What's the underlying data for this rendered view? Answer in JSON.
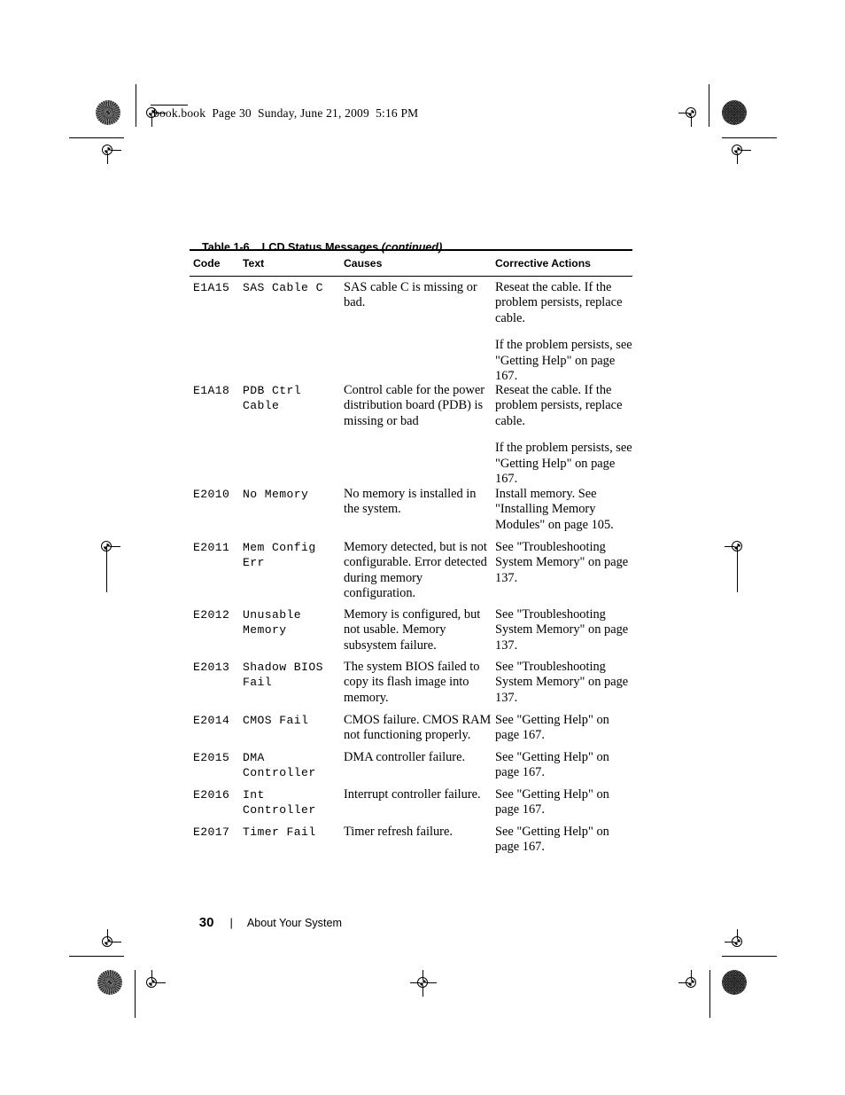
{
  "slug": {
    "text": "book.book  Page 30  Sunday, June 21, 2009  5:16 PM"
  },
  "table": {
    "caption_label": "Table 1-6.",
    "caption_title": "LCD Status Messages",
    "caption_continued": "(continued)",
    "headers": [
      "Code",
      "Text",
      "Causes",
      "Corrective Actions"
    ],
    "rows": [
      {
        "code": "E1A15",
        "text": "SAS Cable C",
        "causes": [
          "SAS cable C is missing or bad."
        ],
        "actions": [
          "Reseat the cable. If the problem persists, replace cable.",
          "If the problem persists, see \"Getting Help\" on page 167."
        ]
      },
      {
        "code": "E1A18",
        "text": "PDB Ctrl\nCable",
        "causes": [
          "Control cable for the power distribution board (PDB) is missing or bad"
        ],
        "actions": [
          "Reseat the cable. If the problem persists, replace cable.",
          "If the problem persists, see \"Getting Help\" on page 167."
        ]
      },
      {
        "code": "E2010",
        "text": "No Memory",
        "causes": [
          "No memory is installed in the system."
        ],
        "actions": [
          "Install memory. See \"Installing Memory Modules\" on page 105."
        ]
      },
      {
        "code": "E2011",
        "text": "Mem Config\nErr",
        "causes": [
          "Memory detected, but is not configurable. Error detected during memory configuration."
        ],
        "actions": [
          "See \"Troubleshooting System Memory\" on page 137."
        ]
      },
      {
        "code": "E2012",
        "text": "Unusable\nMemory",
        "causes": [
          "Memory is configured, but not usable. Memory subsystem failure."
        ],
        "actions": [
          "See \"Troubleshooting System Memory\" on page 137."
        ]
      },
      {
        "code": "E2013",
        "text": "Shadow BIOS\nFail",
        "causes": [
          "The system BIOS failed to copy its flash image into memory."
        ],
        "actions": [
          "See \"Troubleshooting System Memory\" on page 137."
        ]
      },
      {
        "code": "E2014",
        "text": "CMOS Fail",
        "causes": [
          "CMOS failure. CMOS RAM not functioning properly."
        ],
        "actions": [
          "See \"Getting Help\" on page 167."
        ]
      },
      {
        "code": "E2015",
        "text": "DMA\nController",
        "causes": [
          "DMA controller failure."
        ],
        "actions": [
          "See \"Getting Help\" on page 167."
        ]
      },
      {
        "code": "E2016",
        "text": "Int\nController",
        "causes": [
          "Interrupt controller failure."
        ],
        "actions": [
          "See \"Getting Help\" on page 167."
        ]
      },
      {
        "code": "E2017",
        "text": "Timer Fail",
        "causes": [
          "Timer refresh failure."
        ],
        "actions": [
          "See \"Getting Help\" on page 167."
        ]
      }
    ]
  },
  "footer": {
    "page_number": "30",
    "separator": "|",
    "section": "About Your System"
  },
  "layout": {
    "row_tops": [
      316,
      432,
      549,
      609,
      685,
      744,
      804,
      846,
      888,
      930
    ],
    "rule_tops": [
      281,
      311
    ]
  }
}
